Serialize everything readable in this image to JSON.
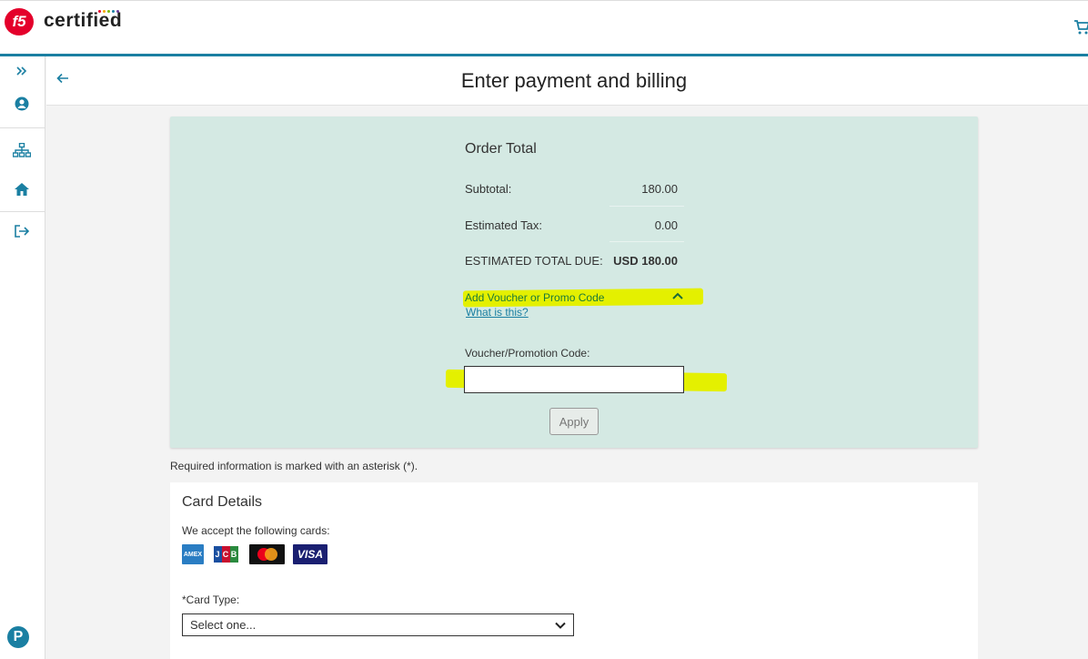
{
  "header": {
    "logo_text": "f5",
    "brand": "certified",
    "brand_dot_colors": [
      "#e4002b",
      "#f7a600",
      "#7ab800",
      "#1a7fa2",
      "#6a3d9a"
    ],
    "cart_icon": "cart-icon"
  },
  "sidebar": {
    "items": [
      {
        "icon": "expand-chevrons-icon"
      },
      {
        "icon": "user-circle-icon"
      },
      {
        "icon": "sitemap-icon"
      },
      {
        "icon": "home-icon"
      },
      {
        "icon": "sign-out-icon"
      }
    ],
    "footer_icon": "P"
  },
  "page": {
    "title": "Enter payment and billing",
    "back_icon": "arrow-left-icon"
  },
  "order": {
    "title": "Order Total",
    "subtotal_label": "Subtotal:",
    "subtotal_value": "180.00",
    "tax_label": "Estimated Tax:",
    "tax_value": "0.00",
    "total_label": "ESTIMATED TOTAL DUE:",
    "total_value": "USD 180.00",
    "voucher_toggle": "Add Voucher or Promo Code",
    "what_link": "What is this?",
    "voucher_label": "Voucher/Promotion Code:",
    "voucher_value": "",
    "apply_label": "Apply"
  },
  "required_note": "Required information is marked with an asterisk (*).",
  "card": {
    "title": "Card Details",
    "accept_text": "We accept the following cards:",
    "logos": {
      "amex": "AMEX",
      "jcb": [
        "J",
        "C",
        "B"
      ],
      "visa": "VISA"
    },
    "card_type_label": "*Card Type:",
    "card_type_selected": "Select one..."
  },
  "colors": {
    "accent": "#1a7fa2",
    "panel": "#d4e9e3",
    "highlight": "#e4f000"
  }
}
